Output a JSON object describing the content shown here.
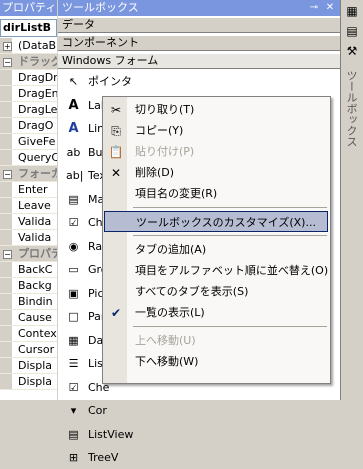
{
  "properties_panel": {
    "title": "プロパティ",
    "object": "dirListB",
    "rows": [
      {
        "type": "prop",
        "expander": "+",
        "text": "(DataB"
      },
      {
        "type": "cat",
        "expander": "−",
        "text": "ドラッグ"
      },
      {
        "type": "prop",
        "text": "DragDr"
      },
      {
        "type": "prop",
        "text": "DragEn"
      },
      {
        "type": "prop",
        "text": "DragLe"
      },
      {
        "type": "prop",
        "text": "DragO"
      },
      {
        "type": "prop",
        "text": "GiveFe"
      },
      {
        "type": "prop",
        "text": "QueryC"
      },
      {
        "type": "cat",
        "expander": "−",
        "text": "フォーカ"
      },
      {
        "type": "prop",
        "text": "Enter"
      },
      {
        "type": "prop",
        "text": "Leave"
      },
      {
        "type": "prop",
        "text": "Valida"
      },
      {
        "type": "prop",
        "text": "Valida"
      },
      {
        "type": "cat",
        "expander": "−",
        "text": "プロパティ"
      },
      {
        "type": "prop",
        "text": "BackC"
      },
      {
        "type": "prop",
        "text": "Backg"
      },
      {
        "type": "prop",
        "text": "Bindin"
      },
      {
        "type": "prop",
        "text": "Cause"
      },
      {
        "type": "prop",
        "text": "Contex"
      },
      {
        "type": "prop",
        "text": "Cursor"
      },
      {
        "type": "prop",
        "text": "Displa"
      },
      {
        "type": "prop",
        "text": "Displa"
      }
    ]
  },
  "toolbox": {
    "title": "ツールボックス",
    "pin_icon": "pin-icon",
    "close_icon": "close-icon",
    "tabs": [
      "データ",
      "コンポーネント",
      "Windows フォーム"
    ],
    "items": [
      {
        "icon": "pointer-icon",
        "glyph": "↖",
        "label": "ポインタ"
      },
      {
        "icon": "label-icon",
        "glyph": "A",
        "label": "Lab"
      },
      {
        "icon": "linklabel-icon",
        "glyph": "A",
        "label": "Lin"
      },
      {
        "icon": "button-icon",
        "glyph": "ab",
        "label": "But"
      },
      {
        "icon": "textbox-icon",
        "glyph": "ab|",
        "label": "Tex"
      },
      {
        "icon": "mainmenu-icon",
        "glyph": "▤",
        "label": "Ma"
      },
      {
        "icon": "checkbox-icon",
        "glyph": "☑",
        "label": "Che"
      },
      {
        "icon": "radiobutton-icon",
        "glyph": "◉",
        "label": "Rad"
      },
      {
        "icon": "groupbox-icon",
        "glyph": "▭",
        "label": "Gro"
      },
      {
        "icon": "picturebox-icon",
        "glyph": "▣",
        "label": "Pic"
      },
      {
        "icon": "panel-icon",
        "glyph": "□",
        "label": "Pan"
      },
      {
        "icon": "datagrid-icon",
        "glyph": "▦",
        "label": "Dat"
      },
      {
        "icon": "listbox-icon",
        "glyph": "☰",
        "label": "Lis"
      },
      {
        "icon": "checkedlistbox-icon",
        "glyph": "☑",
        "label": "Che"
      },
      {
        "icon": "combobox-icon",
        "glyph": "▾",
        "label": "Cor"
      },
      {
        "icon": "listview-icon",
        "glyph": "▤",
        "label": "ListView"
      },
      {
        "icon": "treeview-icon",
        "glyph": "⊞",
        "label": "TreeV"
      }
    ]
  },
  "right_dock": {
    "tab_label": "ツールボックス",
    "icons": [
      "server-explorer-icon",
      "toolbox-icon"
    ]
  },
  "context_menu": {
    "items": [
      {
        "kind": "item",
        "label": "切り取り(T)",
        "icon": "scissors-icon",
        "glyph": "✂",
        "enabled": true
      },
      {
        "kind": "item",
        "label": "コピー(Y)",
        "icon": "copy-icon",
        "glyph": "⎘",
        "enabled": true
      },
      {
        "kind": "item",
        "label": "貼り付け(P)",
        "icon": "paste-icon",
        "glyph": "📋",
        "enabled": false
      },
      {
        "kind": "item",
        "label": "削除(D)",
        "icon": "delete-icon",
        "glyph": "✕",
        "enabled": true
      },
      {
        "kind": "item",
        "label": "項目名の変更(R)",
        "enabled": true
      },
      {
        "kind": "sep"
      },
      {
        "kind": "item",
        "label": "ツールボックスのカスタマイズ(X)...",
        "enabled": true,
        "highlighted": true
      },
      {
        "kind": "sep"
      },
      {
        "kind": "item",
        "label": "タブの追加(A)",
        "enabled": true
      },
      {
        "kind": "item",
        "label": "項目をアルファベット順に並べ替え(O)",
        "enabled": true
      },
      {
        "kind": "item",
        "label": "すべてのタブを表示(S)",
        "enabled": true
      },
      {
        "kind": "item",
        "label": "一覧の表示(L)",
        "icon": "check-icon",
        "glyph": "✔",
        "enabled": true,
        "checked": true
      },
      {
        "kind": "sep"
      },
      {
        "kind": "item",
        "label": "上へ移動(U)",
        "enabled": false
      },
      {
        "kind": "item",
        "label": "下へ移動(W)",
        "enabled": true
      }
    ]
  }
}
